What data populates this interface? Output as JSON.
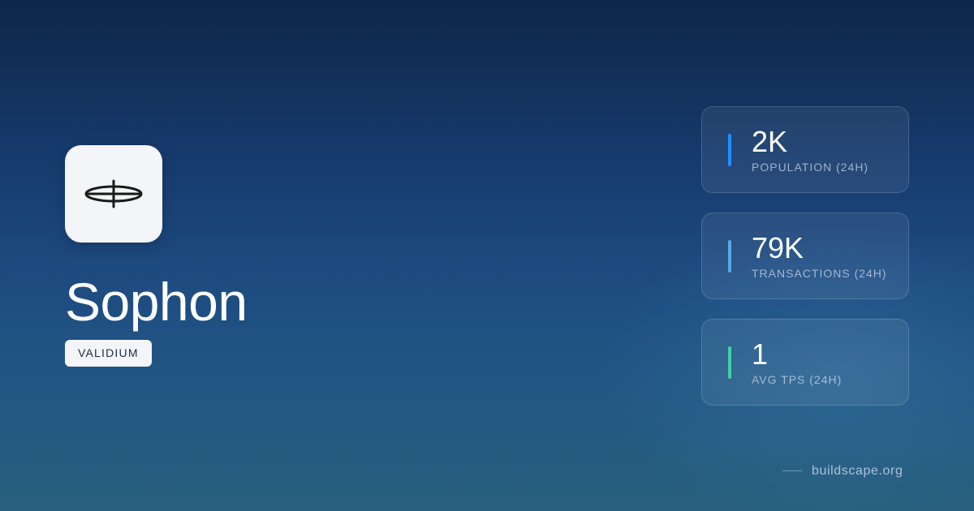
{
  "project": {
    "logo_icon": "sophon-logo-icon",
    "name": "Sophon",
    "category": "VALIDIUM"
  },
  "stats": [
    {
      "value": "2K",
      "label": "POPULATION (24H)",
      "accent_color": "#1e90ff"
    },
    {
      "value": "79K",
      "label": "TRANSACTIONS (24H)",
      "accent_color": "#5aa8e6"
    },
    {
      "value": "1",
      "label": "AVG TPS (24H)",
      "accent_color": "#3fd0a8"
    }
  ],
  "footer": {
    "site": "buildscape.org"
  }
}
